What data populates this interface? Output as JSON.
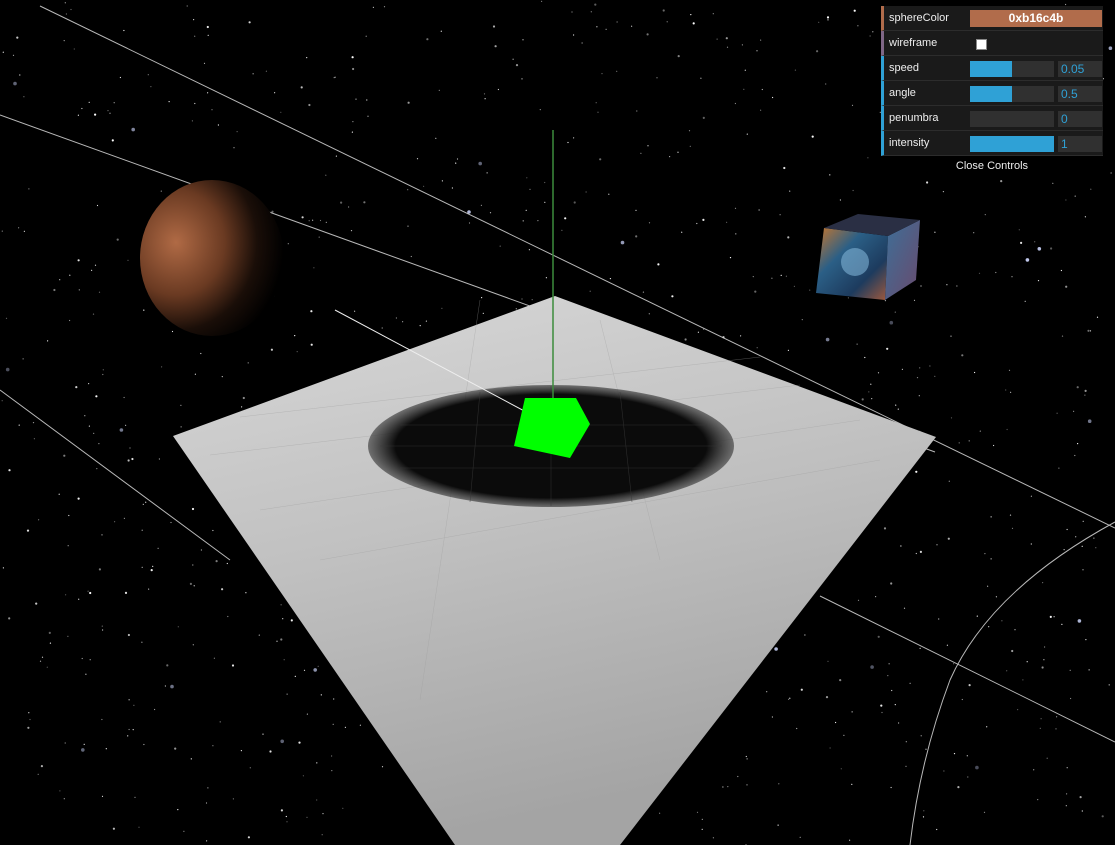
{
  "gui": {
    "sphereColor": {
      "label": "sphereColor",
      "value": "0xb16c4b",
      "color": "#b16c4b"
    },
    "wireframe": {
      "label": "wireframe",
      "checked": false
    },
    "speed": {
      "label": "speed",
      "value": "0.05",
      "fraction": 0.5
    },
    "angle": {
      "label": "angle",
      "value": "0.5",
      "fraction": 0.5
    },
    "penumbra": {
      "label": "penumbra",
      "value": "0",
      "fraction": 0
    },
    "intensity": {
      "label": "intensity",
      "value": "1",
      "fraction": 1
    },
    "close_label": "Close Controls",
    "accent": "#2fa1d6"
  },
  "scene": {
    "background": "#000000",
    "plane_color": "#bdbdbd",
    "box_color": "#00ff00",
    "light_helper_color": "#3c8c3c"
  }
}
